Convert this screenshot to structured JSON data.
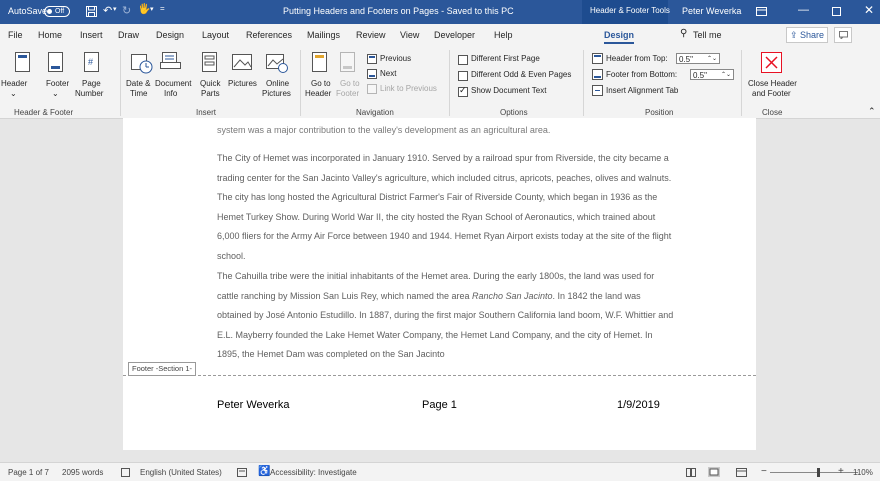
{
  "titlebar": {
    "autosave_label": "AutoSave",
    "autosave_state": "Off",
    "doc_title": "Putting Headers and Footers on Pages - Saved to this PC",
    "context_tools": "Header & Footer Tools",
    "user_name": "Peter Weverka"
  },
  "tabs": [
    "File",
    "Home",
    "Insert",
    "Draw",
    "Design",
    "Layout",
    "References",
    "Mailings",
    "Review",
    "View",
    "Developer",
    "Help"
  ],
  "active_tab": "Design",
  "tell_me": "Tell me",
  "share_label": "Share",
  "ribbon": {
    "header_footer": {
      "header": "Header",
      "footer": "Footer",
      "page": "Page",
      "number": "Number",
      "label": "Header & Footer"
    },
    "insert": {
      "date1": "Date &",
      "date2": "Time",
      "docinfo1": "Document",
      "docinfo2": "Info",
      "quick1": "Quick",
      "quick2": "Parts",
      "pictures": "Pictures",
      "online1": "Online",
      "online2": "Pictures",
      "label": "Insert"
    },
    "navigation": {
      "goto_header1": "Go to",
      "goto_header2": "Header",
      "goto_footer1": "Go to",
      "goto_footer2": "Footer",
      "previous": "Previous",
      "next": "Next",
      "link_previous": "Link to Previous",
      "label": "Navigation"
    },
    "options": {
      "different_first": "Different First Page",
      "different_odd_even": "Different Odd & Even Pages",
      "show_doc_text": "Show Document Text",
      "label": "Options"
    },
    "position": {
      "header_from_top": "Header from Top:",
      "header_value": "0.5\"",
      "footer_from_bottom": "Footer from Bottom:",
      "footer_value": "0.5\"",
      "alignment_tab": "Insert Alignment Tab",
      "label": "Position"
    },
    "close": {
      "close1": "Close Header",
      "close2": "and Footer",
      "label": "Close"
    }
  },
  "document": {
    "para0": "system was a major contribution to the valley's development as an agricultural area.",
    "para1": "The City of Hemet was incorporated in January 1910. Served by a railroad spur from Riverside, the city became a trading center for the San Jacinto Valley's agriculture, which included citrus, apricots, peaches, olives and walnuts. The city has long hosted the Agricultural District Farmer's Fair of Riverside County, which began in 1936 as the Hemet Turkey Show. During World War II, the city hosted the Ryan School of Aeronautics, which trained about 6,000 fliers for the Army Air Force between 1940 and 1944. Hemet Ryan Airport exists today at the site of the flight school.",
    "para2a": "The Cahuilla tribe were the initial inhabitants of the Hemet area. During the early 1800s, the land was used for cattle ranching by Mission San Luis Rey, which named the area ",
    "para2_italic": "Rancho San Jacinto",
    "para2b": ". In 1842 the land was obtained by José Antonio Estudillo. In 1887, during the first major Southern California land boom, W.F. Whittier and E.L. Mayberry founded the Lake Hemet Water Company, the Hemet Land Company, and the city of Hemet. In 1895, the Hemet Dam was completed on the San Jacinto",
    "footer_tag": "Footer -Section 1-",
    "footer_left": "Peter Weverka",
    "footer_center": "Page 1",
    "footer_right": "1/9/2019"
  },
  "status": {
    "page": "Page 1 of 7",
    "words": "2095 words",
    "language": "English (United States)",
    "accessibility": "Accessibility: Investigate",
    "zoom": "110%"
  },
  "colors": {
    "accent": "#2b579a",
    "close_red": "#e81123"
  }
}
